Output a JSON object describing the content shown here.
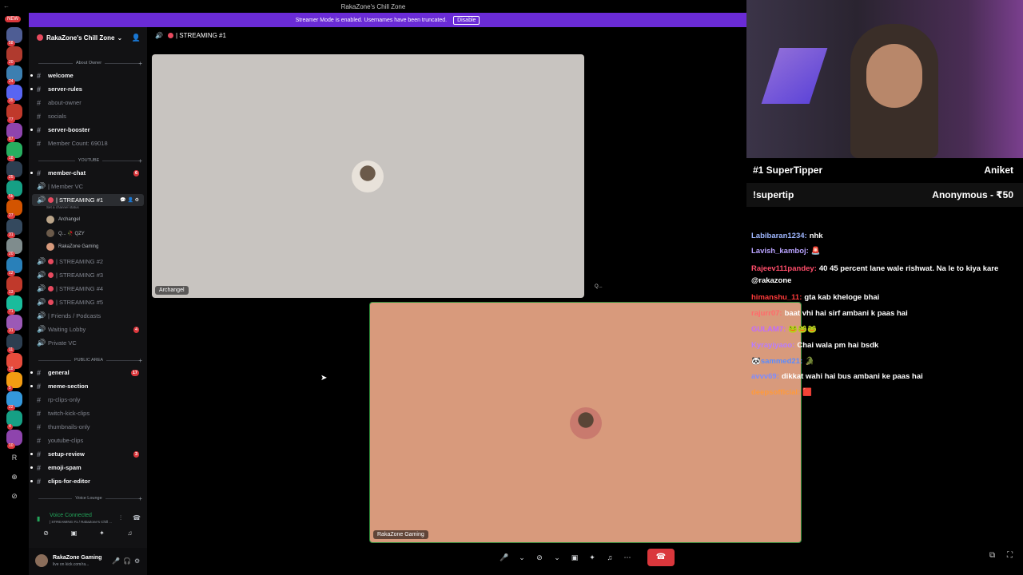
{
  "window": {
    "title": "RakaZone's Chill Zone"
  },
  "banner": {
    "text": "Streamer Mode is enabled. Usernames have been truncated.",
    "button": "Disable"
  },
  "rail": {
    "new_badge": "NEW",
    "badges": [
      "58",
      "20",
      "24",
      "35",
      "77",
      "87",
      "18",
      "25",
      "5k",
      "27",
      "31",
      "20",
      "12",
      "13",
      "71",
      "31",
      "11",
      "18",
      "5",
      "22",
      "4",
      "10",
      "8",
      "3"
    ],
    "letter": "R"
  },
  "server": {
    "name": "RakaZone's Chill Zone",
    "chevron": "⌄"
  },
  "categories": {
    "about_owner": "About Owner",
    "youtube": "YOUTUBE",
    "public_area": "PUBLIC AREA",
    "voice_lounge": "Voice Lounge"
  },
  "channels": {
    "welcome": "welcome",
    "server_rules": "server-rules",
    "about_owner": "about-owner",
    "socials": "socials",
    "server_booster": "server-booster",
    "member_count": "Member Count: 69018",
    "member_chat": "member-chat",
    "member_chat_count": "6",
    "member_vc": "| Member VC",
    "streaming1": "| STREAMING #1",
    "channel_status": "Set a channel status",
    "streaming2": "| STREAMING #2",
    "streaming3": "| STREAMING #3",
    "streaming4": "| STREAMING #4",
    "streaming5": "| STREAMING #5",
    "friends_podcasts": "| Friends / Podcasts",
    "waiting_lobby": "Waiting Lobby",
    "waiting_lobby_count": "4",
    "private_vc": "Private VC",
    "general": "general",
    "general_count": "17",
    "meme_section": "meme-section",
    "rp_clips_only": "rp-clips-only",
    "twitch_kick_clips": "twitch-kick-clips",
    "thumbnails_only": "thumbnails-only",
    "youtube_clips": "youtube-clips",
    "setup_review": "setup-review",
    "setup_review_count": "3",
    "emoji_spam": "emoji-spam",
    "clips_for_editor": "clips-for-editor"
  },
  "voice_members": [
    {
      "name": "Archangel"
    },
    {
      "name": "Q... 🥀 QZY"
    },
    {
      "name": "RakaZone Gaming"
    }
  ],
  "voice_panel": {
    "title": "Voice Connected",
    "subtitle": "| STREAMING #1 / RakaZone's Chill ..."
  },
  "user": {
    "name": "RakaZone Gaming",
    "status": "live on kick.com/ra..."
  },
  "main": {
    "channel_title": "| STREAMING #1",
    "tile1_label": "Archangel",
    "tile2_label": "RakaZone Gaming",
    "q_label": "Q..."
  },
  "overlay": {
    "tipper_label": "#1 SuperTipper",
    "tipper_name": "Aniket",
    "command": "!supertip",
    "last_tip": "Anonymous - ₹50"
  },
  "chat": [
    {
      "user": "Labibaran1234:",
      "text": "nhk",
      "color": "#9fb7ff"
    },
    {
      "user": "Lavish_kamboj:",
      "text": "🚨",
      "color": "#b9a3ff"
    },
    {
      "user": "Rajeev111pandey:",
      "text": "40 45 percent lane wale rishwat. Na le to kiya kare @rakazone",
      "color": "#ff4d6a"
    },
    {
      "user": "himanshu_11:",
      "text": "gta kab khelоge bhai",
      "color": "#ff3b3b"
    },
    {
      "user": "rajurr07:",
      "text": "baat vhi hai sirf ambani k paas hai",
      "color": "#ff6b6b"
    },
    {
      "user": "GULAM7:",
      "text": "🐸🐸🐸",
      "color": "#c06bff"
    },
    {
      "user": "Kyrayiyaoo:",
      "text": "Chai wala pm hai bsdk",
      "color": "#b87cff"
    },
    {
      "user": "🐼sammed21:",
      "text": "🐊",
      "color": "#5b8cff"
    },
    {
      "user": "avvv69:",
      "text": "dikkat wahi hai bus ambani ke paas hai",
      "color": "#7d8cff"
    },
    {
      "user": "deepsofficial:",
      "text": "🟥",
      "color": "#ff9a3b"
    }
  ],
  "colors": {
    "accent": "#6a2bd6",
    "live": "#da373c",
    "connected": "#23a55a"
  }
}
